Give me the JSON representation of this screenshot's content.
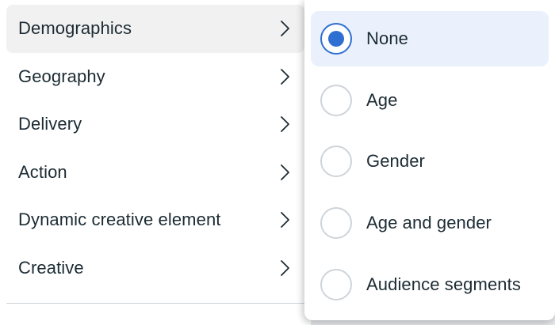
{
  "breakdown_menu": {
    "items": [
      {
        "label": "Demographics",
        "active": true
      },
      {
        "label": "Geography",
        "active": false
      },
      {
        "label": "Delivery",
        "active": false
      },
      {
        "label": "Action",
        "active": false
      },
      {
        "label": "Dynamic creative element",
        "active": false
      },
      {
        "label": "Creative",
        "active": false
      }
    ],
    "chevron_icon": "chevron-right-icon"
  },
  "demographics_submenu": {
    "options": [
      {
        "label": "None",
        "selected": true
      },
      {
        "label": "Age",
        "selected": false
      },
      {
        "label": "Gender",
        "selected": false
      },
      {
        "label": "Age and gender",
        "selected": false
      },
      {
        "label": "Audience segments",
        "selected": false
      }
    ]
  },
  "colors": {
    "accent": "#2f6fd1",
    "selected_background": "#eaf1fd",
    "active_item_background": "#f1f1f1",
    "text": "#1c2b33"
  }
}
